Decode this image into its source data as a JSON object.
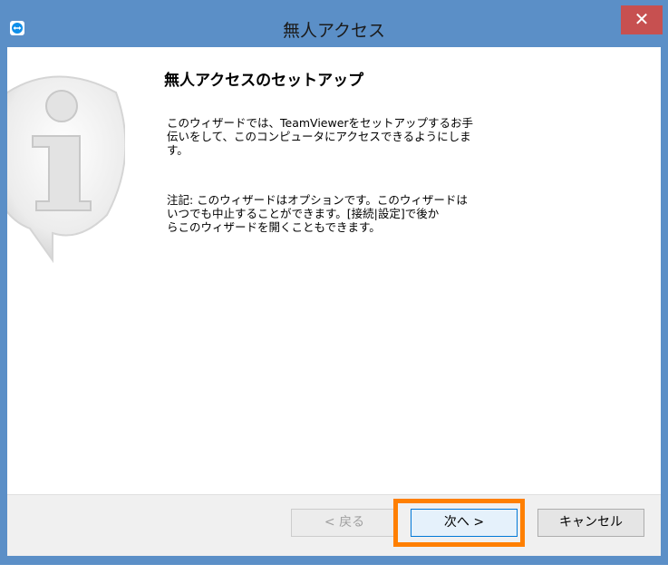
{
  "window": {
    "title": "無人アクセス",
    "close_label": "✕",
    "app_icon": "teamviewer-icon"
  },
  "content": {
    "heading": "無人アクセスのセットアップ",
    "paragraph1": "このウィザードでは、TeamViewerをセットアップするお手\n伝いをして、このコンピュータにアクセスできるようにしま\nす。",
    "paragraph2": "注記: このウィザードはオプションです。このウィザードは\nいつでも中止することができます。[接続|設定]で後か\nらこのウィザードを開くこともできます。",
    "graphic_icon": "info-icon"
  },
  "footer": {
    "back_label": "< 戻る",
    "next_label": "次へ >",
    "cancel_label": "キャンセル"
  },
  "colors": {
    "frame": "#5b8fc7",
    "close": "#c75050",
    "highlight": "#ff7f00"
  }
}
